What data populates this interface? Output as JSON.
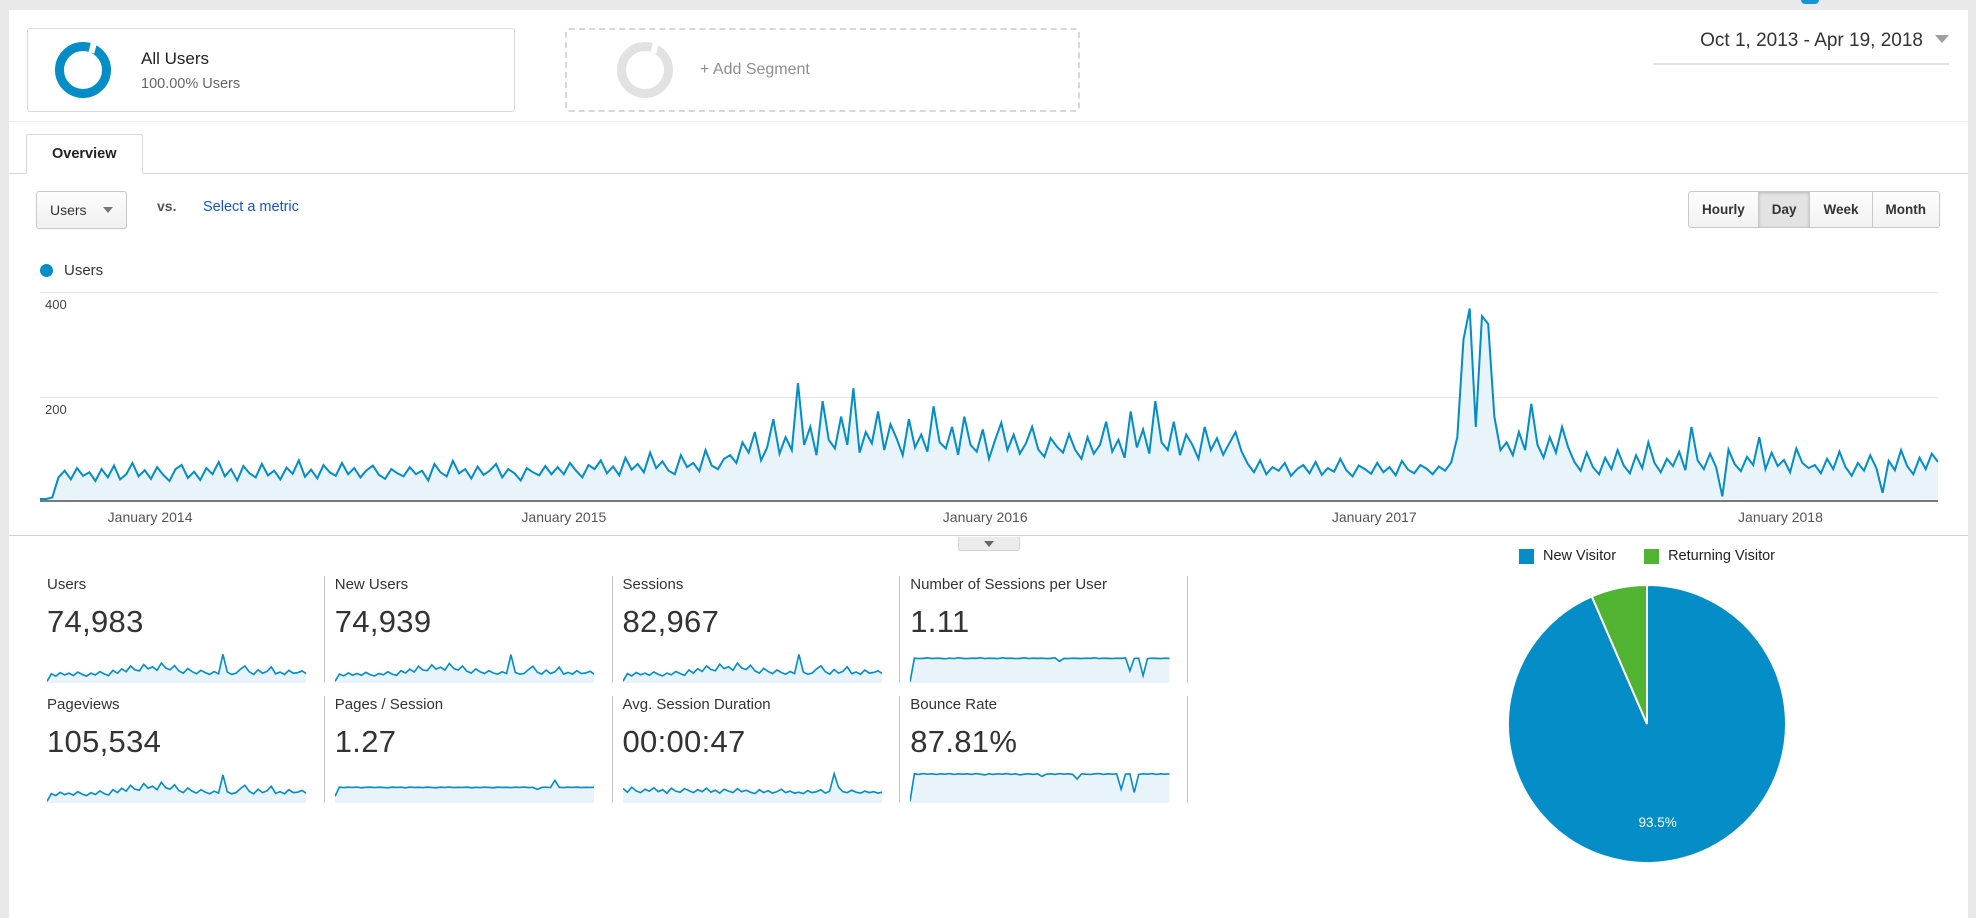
{
  "colors": {
    "blue": "#058dc7",
    "green": "#50b432",
    "chart_fill": "#e9f3fa",
    "link": "#1155cc",
    "help_fragment": "#1197d4"
  },
  "header": {
    "segment_card": {
      "title": "All Users",
      "subtitle": "100.00% Users"
    },
    "add_segment_label": "+ Add Segment",
    "date_range": "Oct 1, 2013 - Apr 19, 2018"
  },
  "tabs": {
    "overview": "Overview"
  },
  "controls": {
    "metric_select": "Users",
    "vs_label": "vs.",
    "select_metric_link": "Select a metric",
    "granularity": [
      "Hourly",
      "Day",
      "Week",
      "Month"
    ],
    "granularity_selected": "Day"
  },
  "metrics": {
    "cards": [
      {
        "label": "Users",
        "value": "74,983",
        "spark": "users"
      },
      {
        "label": "New Users",
        "value": "74,939",
        "spark": "new_users"
      },
      {
        "label": "Sessions",
        "value": "82,967",
        "spark": "sessions"
      },
      {
        "label": "Number of Sessions per User",
        "value": "1.11",
        "spark": "spu"
      },
      {
        "label": "Pageviews",
        "value": "105,534",
        "spark": "pageviews"
      },
      {
        "label": "Pages / Session",
        "value": "1.27",
        "spark": "pages_session"
      },
      {
        "label": "Avg. Session Duration",
        "value": "00:00:47",
        "spark": "duration"
      },
      {
        "label": "Bounce Rate",
        "value": "87.81%",
        "spark": "bounce"
      }
    ]
  },
  "chart_data": {
    "main": {
      "type": "area",
      "series_label": "Users",
      "ylim": [
        0,
        400
      ],
      "yticks": {
        "top": "400",
        "mid": "200"
      },
      "grid": true,
      "legend_position": "top-left",
      "xticks": [
        {
          "label": "January 2014",
          "pos": "5.8%"
        },
        {
          "label": "January 2015",
          "pos": "27.6%"
        },
        {
          "label": "January 2016",
          "pos": "49.8%"
        },
        {
          "label": "January 2017",
          "pos": "70.3%"
        },
        {
          "label": "January 2018",
          "pos": "91.7%"
        }
      ],
      "values": [
        0,
        0,
        3,
        42,
        55,
        38,
        60,
        45,
        52,
        35,
        58,
        42,
        65,
        38,
        48,
        70,
        44,
        56,
        39,
        62,
        47,
        35,
        58,
        66,
        41,
        53,
        37,
        60,
        48,
        72,
        44,
        58,
        36,
        64,
        50,
        42,
        68,
        46,
        55,
        38,
        61,
        49,
        75,
        43,
        57,
        40,
        66,
        52,
        45,
        70,
        48,
        60,
        42,
        56,
        65,
        47,
        39,
        58,
        50,
        44,
        62,
        48,
        55,
        36,
        68,
        52,
        44,
        74,
        50,
        58,
        40,
        63,
        47,
        55,
        68,
        42,
        58,
        50,
        36,
        60,
        52,
        46,
        64,
        48,
        62,
        48,
        70,
        55,
        42,
        66,
        58,
        75,
        50,
        63,
        46,
        80,
        57,
        68,
        52,
        90,
        60,
        73,
        55,
        48,
        85,
        62,
        70,
        54,
        95,
        65,
        58,
        78,
        85,
        70,
        110,
        90,
        130,
        75,
        100,
        155,
        88,
        120,
        95,
        225,
        105,
        140,
        85,
        190,
        115,
        98,
        160,
        105,
        215,
        90,
        130,
        108,
        170,
        95,
        145,
        118,
        85,
        155,
        100,
        125,
        92,
        180,
        110,
        98,
        140,
        86,
        160,
        105,
        92,
        135,
        78,
        115,
        148,
        95,
        125,
        88,
        108,
        140,
        96,
        82,
        118,
        102,
        90,
        126,
        95,
        78,
        120,
        88,
        105,
        150,
        92,
        115,
        80,
        170,
        100,
        135,
        88,
        190,
        110,
        95,
        150,
        85,
        125,
        105,
        78,
        140,
        95,
        118,
        86,
        108,
        130,
        92,
        68,
        52,
        75,
        48,
        62,
        55,
        70,
        45,
        58,
        66,
        50,
        72,
        47,
        60,
        53,
        78,
        56,
        44,
        65,
        58,
        49,
        70,
        52,
        62,
        46,
        74,
        57,
        50,
        66,
        59,
        48,
        63,
        55,
        71,
        120,
        310,
        370,
        140,
        355,
        340,
        160,
        95,
        110,
        85,
        130,
        95,
        185,
        105,
        80,
        120,
        90,
        140,
        100,
        72,
        55,
        90,
        62,
        48,
        80,
        58,
        95,
        65,
        50,
        85,
        60,
        110,
        70,
        52,
        78,
        64,
        92,
        56,
        140,
        75,
        58,
        88,
        62,
        5,
        96,
        68,
        54,
        82,
        66,
        120,
        58,
        90,
        64,
        76,
        52,
        98,
        70,
        60,
        66,
        50,
        78,
        58,
        92,
        62,
        45,
        70,
        55,
        85,
        60,
        12,
        74,
        56,
        95,
        64,
        48,
        80,
        58,
        88,
        72
      ]
    },
    "sparks": {
      "users": {
        "ymax": 110,
        "values": [
          2,
          28,
          20,
          32,
          24,
          30,
          22,
          34,
          26,
          20,
          30,
          24,
          36,
          28,
          22,
          40,
          30,
          45,
          35,
          55,
          42,
          38,
          60,
          45,
          52,
          40,
          65,
          48,
          42,
          56,
          38,
          30,
          46,
          36,
          28,
          40,
          32,
          26,
          36,
          28,
          95,
          34,
          26,
          30,
          44,
          55,
          35,
          26,
          42,
          30,
          36,
          52,
          28,
          34,
          26,
          40,
          30,
          32,
          38,
          28
        ]
      },
      "new_users": {
        "ymax": 110,
        "values": [
          2,
          27,
          21,
          31,
          23,
          29,
          23,
          33,
          25,
          21,
          29,
          25,
          35,
          27,
          23,
          39,
          31,
          44,
          34,
          54,
          41,
          39,
          59,
          44,
          51,
          41,
          64,
          47,
          41,
          55,
          37,
          31,
          45,
          35,
          29,
          39,
          31,
          27,
          35,
          29,
          94,
          33,
          27,
          29,
          43,
          54,
          34,
          27,
          41,
          29,
          35,
          51,
          27,
          33,
          27,
          39,
          29,
          31,
          37,
          27
        ]
      },
      "sessions": {
        "ymax": 115,
        "values": [
          3,
          30,
          22,
          34,
          26,
          32,
          24,
          36,
          28,
          22,
          32,
          26,
          38,
          30,
          24,
          43,
          32,
          48,
          38,
          58,
          45,
          40,
          64,
          48,
          55,
          42,
          68,
          50,
          45,
          60,
          40,
          32,
          49,
          38,
          30,
          43,
          34,
          28,
          38,
          30,
          99,
          36,
          28,
          32,
          47,
          58,
          37,
          28,
          45,
          32,
          38,
          55,
          30,
          36,
          28,
          43,
          32,
          34,
          40,
          30
        ]
      },
      "spu": {
        "ymax": 1.5,
        "values": [
          0,
          1.12,
          1.1,
          1.11,
          1.13,
          1.1,
          1.12,
          1.11,
          1.09,
          1.12,
          1.1,
          1.13,
          1.11,
          1.1,
          1.12,
          1.11,
          1.13,
          1.1,
          1.12,
          1.11,
          1.1,
          1.13,
          1.11,
          1.12,
          1.1,
          1.11,
          1.13,
          1.1,
          1.12,
          1.11,
          1.12,
          1.1,
          1.11,
          1.13,
          0.97,
          1.11,
          1.1,
          1.12,
          1.11,
          1.1,
          1.12,
          1.11,
          1.13,
          1.1,
          1.12,
          1.11,
          1.1,
          1.12,
          1.11,
          1.13,
          0.52,
          1.11,
          1.12,
          0.3,
          1.1,
          1.12,
          1.11,
          1.1,
          1.12,
          1.11
        ]
      },
      "pageviews": {
        "ymax": 130,
        "values": [
          3,
          34,
          26,
          40,
          30,
          36,
          28,
          42,
          32,
          26,
          38,
          30,
          45,
          34,
          28,
          50,
          38,
          56,
          44,
          68,
          52,
          48,
          75,
          56,
          64,
          50,
          80,
          58,
          52,
          70,
          46,
          38,
          57,
          44,
          36,
          50,
          40,
          33,
          44,
          36,
          110,
          42,
          33,
          38,
          55,
          68,
          43,
          33,
          52,
          38,
          45,
          64,
          35,
          42,
          33,
          50,
          38,
          40,
          47,
          35
        ]
      },
      "pages_session": {
        "ymax": 2.8,
        "values": [
          0.5,
          1.3,
          1.26,
          1.29,
          1.27,
          1.31,
          1.25,
          1.28,
          1.3,
          1.26,
          1.29,
          1.27,
          1.24,
          1.3,
          1.27,
          1.29,
          1.25,
          1.31,
          1.27,
          1.28,
          1.26,
          1.3,
          1.27,
          1.25,
          1.29,
          1.27,
          1.31,
          1.26,
          1.28,
          1.27,
          1.3,
          1.25,
          1.28,
          1.26,
          1.29,
          1.27,
          1.25,
          1.3,
          1.27,
          1.28,
          1.26,
          1.29,
          1.27,
          1.31,
          1.26,
          1.28,
          1.1,
          1.27,
          1.29,
          1.26,
          1.9,
          1.28,
          1.26,
          1.29,
          1.27,
          1.3,
          1.26,
          1.28,
          1.27,
          1.29
        ]
      },
      "duration": {
        "ymax": 130,
        "values": [
          55,
          40,
          60,
          45,
          38,
          52,
          44,
          58,
          42,
          50,
          36,
          56,
          44,
          40,
          54,
          46,
          38,
          50,
          42,
          56,
          40,
          48,
          36,
          52,
          44,
          38,
          54,
          42,
          48,
          40,
          34,
          50,
          38,
          46,
          36,
          42,
          52,
          38,
          44,
          36,
          40,
          34,
          46,
          38,
          42,
          50,
          36,
          44,
          115,
          60,
          42,
          38,
          48,
          40,
          36,
          44,
          38,
          42,
          36,
          40
        ]
      },
      "bounce": {
        "ymax": 100,
        "values": [
          2,
          88,
          86,
          89,
          87,
          88,
          86,
          88,
          87,
          89,
          86,
          88,
          87,
          88,
          86,
          89,
          87,
          85,
          88,
          86,
          88,
          87,
          89,
          86,
          88,
          85,
          87,
          88,
          86,
          88,
          80,
          87,
          88,
          86,
          89,
          87,
          88,
          86,
          72,
          88,
          87,
          86,
          88,
          89,
          86,
          88,
          87,
          88,
          40,
          87,
          88,
          30,
          86,
          88,
          87,
          89,
          86,
          88,
          87,
          88
        ]
      }
    },
    "pie": {
      "type": "pie",
      "slices": [
        {
          "label": "New Visitor",
          "pct": 93.5
        },
        {
          "label": "Returning Visitor",
          "pct": 6.5
        }
      ],
      "shown_label": "93.5%"
    }
  }
}
